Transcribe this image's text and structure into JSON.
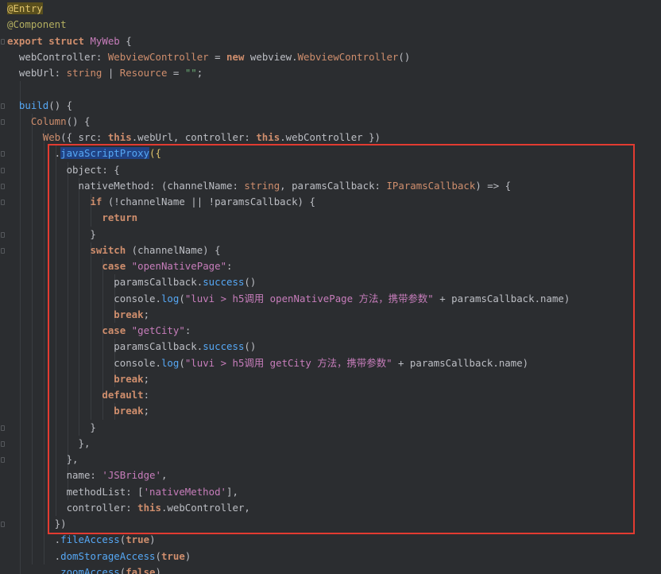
{
  "editor": {
    "lines": [
      [
        {
          "t": "@Entry",
          "c": "entry-hl"
        }
      ],
      [
        {
          "t": "@Component",
          "c": "ann"
        }
      ],
      [
        {
          "t": "export",
          "c": "kw"
        },
        {
          "t": " "
        },
        {
          "t": "struct",
          "c": "kw"
        },
        {
          "t": " "
        },
        {
          "t": "MyWeb",
          "c": "cls"
        },
        {
          "t": " {"
        }
      ],
      [
        {
          "t": "  webController: "
        },
        {
          "t": "WebviewController",
          "c": "typ"
        },
        {
          "t": " = "
        },
        {
          "t": "new",
          "c": "kw"
        },
        {
          "t": " webview."
        },
        {
          "t": "WebviewController",
          "c": "typ"
        },
        {
          "t": "()"
        }
      ],
      [
        {
          "t": "  webUrl: "
        },
        {
          "t": "string",
          "c": "typ"
        },
        {
          "t": " | "
        },
        {
          "t": "Resource",
          "c": "typ"
        },
        {
          "t": " = "
        },
        {
          "t": "\"\"",
          "c": "str"
        },
        {
          "t": ";"
        }
      ],
      [],
      [
        {
          "t": "  "
        },
        {
          "t": "build",
          "c": "fn"
        },
        {
          "t": "() {"
        }
      ],
      [
        {
          "t": "    "
        },
        {
          "t": "Column",
          "c": "typ"
        },
        {
          "t": "() {"
        }
      ],
      [
        {
          "t": "      "
        },
        {
          "t": "Web",
          "c": "typ"
        },
        {
          "t": "({ src: "
        },
        {
          "t": "this",
          "c": "ths"
        },
        {
          "t": ".webUrl, controller: "
        },
        {
          "t": "this",
          "c": "ths"
        },
        {
          "t": ".webController })"
        }
      ],
      [
        {
          "t": "        ."
        },
        {
          "t": "javaScriptProxy",
          "c": "fn hl"
        },
        {
          "t": "({",
          "c": "brk"
        }
      ],
      [
        {
          "t": "          object: {"
        }
      ],
      [
        {
          "t": "            nativeMethod: (channelName: "
        },
        {
          "t": "string",
          "c": "typ"
        },
        {
          "t": ", paramsCallback: "
        },
        {
          "t": "IParamsCallback",
          "c": "typ"
        },
        {
          "t": ") => {"
        }
      ],
      [
        {
          "t": "              "
        },
        {
          "t": "if",
          "c": "kw"
        },
        {
          "t": " (!channelName || !paramsCallback) {"
        }
      ],
      [
        {
          "t": "                "
        },
        {
          "t": "return",
          "c": "kw"
        }
      ],
      [
        {
          "t": "              }"
        }
      ],
      [
        {
          "t": "              "
        },
        {
          "t": "switch",
          "c": "kw"
        },
        {
          "t": " (channelName) {"
        }
      ],
      [
        {
          "t": "                "
        },
        {
          "t": "case",
          "c": "kw"
        },
        {
          "t": " "
        },
        {
          "t": "\"openNativePage\"",
          "c": "strp"
        },
        {
          "t": ":"
        }
      ],
      [
        {
          "t": "                  paramsCallback."
        },
        {
          "t": "success",
          "c": "fn"
        },
        {
          "t": "()"
        }
      ],
      [
        {
          "t": "                  console."
        },
        {
          "t": "log",
          "c": "fn"
        },
        {
          "t": "("
        },
        {
          "t": "\"luvi > h5调用 openNativePage 方法，携带参数\"",
          "c": "strp"
        },
        {
          "t": " + paramsCallback.name)"
        }
      ],
      [
        {
          "t": "                  "
        },
        {
          "t": "break",
          "c": "kw"
        },
        {
          "t": ";"
        }
      ],
      [
        {
          "t": "                "
        },
        {
          "t": "case",
          "c": "kw"
        },
        {
          "t": " "
        },
        {
          "t": "\"getCity\"",
          "c": "strp"
        },
        {
          "t": ":"
        }
      ],
      [
        {
          "t": "                  paramsCallback."
        },
        {
          "t": "success",
          "c": "fn"
        },
        {
          "t": "()"
        }
      ],
      [
        {
          "t": "                  console."
        },
        {
          "t": "log",
          "c": "fn"
        },
        {
          "t": "("
        },
        {
          "t": "\"luvi > h5调用 getCity 方法，携带参数\"",
          "c": "strp"
        },
        {
          "t": " + paramsCallback.name)"
        }
      ],
      [
        {
          "t": "                  "
        },
        {
          "t": "break",
          "c": "kw"
        },
        {
          "t": ";"
        }
      ],
      [
        {
          "t": "                "
        },
        {
          "t": "default",
          "c": "kw"
        },
        {
          "t": ":"
        }
      ],
      [
        {
          "t": "                  "
        },
        {
          "t": "break",
          "c": "kw"
        },
        {
          "t": ";"
        }
      ],
      [
        {
          "t": "              }"
        }
      ],
      [
        {
          "t": "            },"
        }
      ],
      [
        {
          "t": "          },"
        }
      ],
      [
        {
          "t": "          name: "
        },
        {
          "t": "'JSBridge'",
          "c": "strp"
        },
        {
          "t": ","
        }
      ],
      [
        {
          "t": "          methodList: ["
        },
        {
          "t": "'nativeMethod'",
          "c": "strp"
        },
        {
          "t": "],"
        }
      ],
      [
        {
          "t": "          controller: "
        },
        {
          "t": "this",
          "c": "ths"
        },
        {
          "t": ".webController,"
        }
      ],
      [
        {
          "t": "        })"
        }
      ],
      [
        {
          "t": "        ."
        },
        {
          "t": "fileAccess",
          "c": "fn"
        },
        {
          "t": "("
        },
        {
          "t": "true",
          "c": "kw"
        },
        {
          "t": ")"
        }
      ],
      [
        {
          "t": "        ."
        },
        {
          "t": "domStorageAccess",
          "c": "fn"
        },
        {
          "t": "("
        },
        {
          "t": "true",
          "c": "kw"
        },
        {
          "t": ")"
        }
      ],
      [
        {
          "t": "        ."
        },
        {
          "t": "zoomAccess",
          "c": "fn"
        },
        {
          "t": "("
        },
        {
          "t": "false",
          "c": "kw"
        },
        {
          "t": ")"
        }
      ]
    ]
  },
  "colors": {
    "background": "#2b2d30",
    "highlight_border": "#e23b31",
    "selection": "#214283"
  }
}
